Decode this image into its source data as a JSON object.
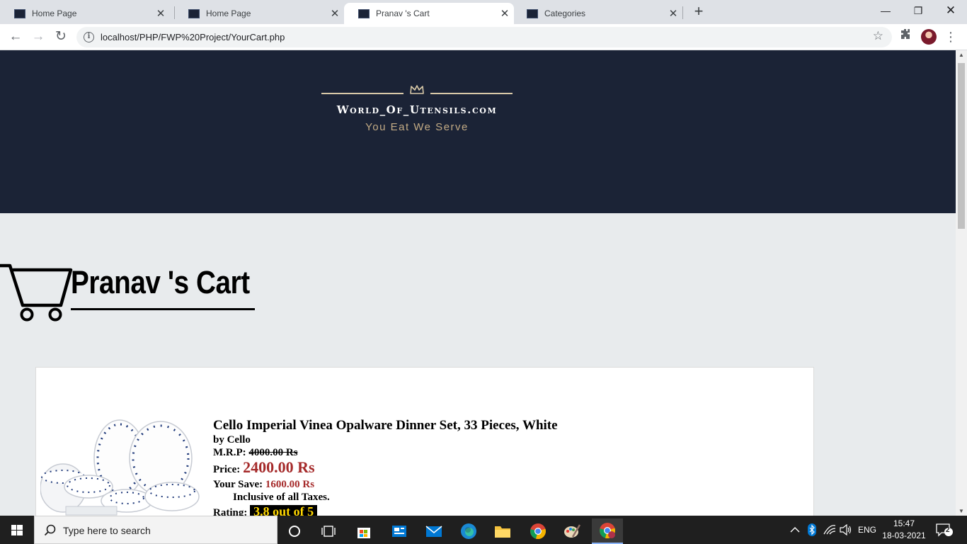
{
  "browser": {
    "tabs": [
      {
        "label": "Home Page",
        "active": false
      },
      {
        "label": "Home Page",
        "active": false
      },
      {
        "label": "Pranav 's Cart",
        "active": true
      },
      {
        "label": "Categories",
        "active": false
      }
    ],
    "url": "localhost/PHP/FWP%20Project/YourCart.php"
  },
  "hero": {
    "brand": "World_Of_Utensils.com",
    "tagline": "You Eat We Serve"
  },
  "cart": {
    "title": "Pranav 's Cart"
  },
  "product": {
    "title": "Cello Imperial Vinea Opalware Dinner Set, 33 Pieces, White",
    "brand_line": "by Cello",
    "mrp_label": "M.R.P:",
    "mrp_value": "4000.00 Rs",
    "price_label": "Price:",
    "price_value": "2400.00 Rs",
    "save_label": "Your Save:",
    "save_value": "1600.00 Rs",
    "tax_note": "Inclusive of all Taxes.",
    "rating_label": "Rating:",
    "rating_value": "3.8 out of 5"
  },
  "taskbar": {
    "search_placeholder": "Type here to search",
    "language": "ENG",
    "time": "15:47",
    "date": "18-03-2021",
    "notification_count": "2"
  },
  "colors": {
    "hero_bg": "#1b2336",
    "gold": "#c3ab85",
    "price": "#a52a2a",
    "rating_text": "#ffd700"
  },
  "icons": [
    "back-icon",
    "forward-icon",
    "reload-icon",
    "info-icon",
    "star-icon",
    "extensions-icon",
    "crown-icon",
    "cart-icon",
    "windows-icon",
    "search-icon",
    "cortana-icon",
    "task-view-icon",
    "store-icon",
    "mail-icon",
    "edge-icon",
    "file-explorer-icon",
    "chrome-icon",
    "paint-icon",
    "wifi-icon",
    "volume-icon",
    "bluetooth-icon"
  ]
}
